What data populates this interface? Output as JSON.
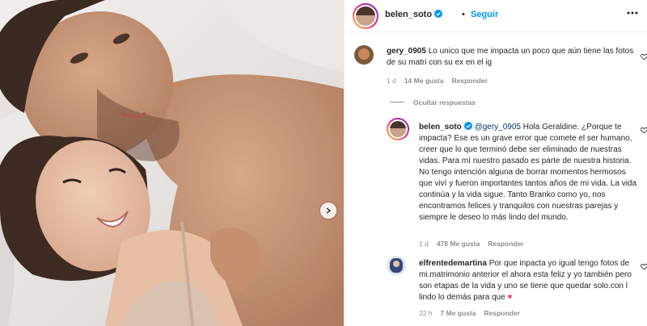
{
  "post": {
    "author": "belen_soto",
    "follow_label": "Seguir",
    "separator": "•"
  },
  "comments": [
    {
      "user": "gery_0905",
      "text": "Lo unico que me impacta un poco que aún tiene las fotos de su matri con su ex en el ig",
      "time": "1 d",
      "likes": "14 Me gusta",
      "reply": "Responder"
    }
  ],
  "replies_toggle": "Ocultar respuestas",
  "replies": [
    {
      "user": "belen_soto",
      "mention": "@gery_0905",
      "text": " Hola Geraldine. ¿Porque te impacta? Ese es un grave error que comete el ser humano, creer que lo que terminó debe ser eliminado de nuestras vidas. Para mí nuestro pasado es parte de nuestra historia. No tengo intención alguna de borrar momentos hermosos que viví y fueron importantes tantos años de mi vida. La vida continúa y la vida sigue. Tanto Branko como yo, nos encontramos felices y tranquilos con nuestras parejas y siempre le deseo lo más lindo del mundo.",
      "time": "1 d",
      "likes": "478 Me gusta",
      "reply": "Responder"
    }
  ],
  "comments2": [
    {
      "user": "elfrentedemartina",
      "text": "Por que inpacta yo igual tengo fotos de mi.matrimonio anterior el ahora esta feliz y yo también pero son etapas de la vida y uno se tiene que quedar solo.con l lindo lo demás para que",
      "emoji": "♥",
      "time": "22 h",
      "likes": "7 Me gusta",
      "reply": "Responder"
    }
  ],
  "colors": {
    "accent": "#0095f6",
    "verified": "#0095f6",
    "muted": "#8e8e8e",
    "heart": "#ed4956"
  },
  "icons": [
    "verified-badge-icon",
    "more-options-icon",
    "heart-outline-icon",
    "chevron-right-icon"
  ]
}
